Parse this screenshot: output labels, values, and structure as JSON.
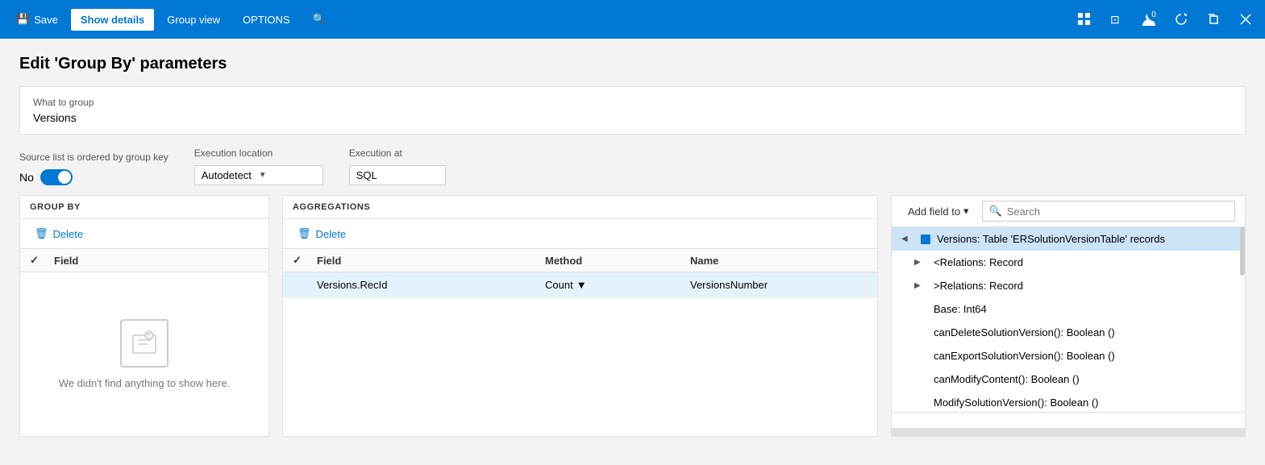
{
  "titleBar": {
    "save_label": "Save",
    "show_details_label": "Show details",
    "group_view_label": "Group view",
    "options_label": "OPTIONS",
    "icons": {
      "grid": "⊞",
      "office": "⊡",
      "user_badge": "0",
      "refresh": "↻",
      "restore": "⧉",
      "close": "✕"
    }
  },
  "page": {
    "title": "Edit 'Group By' parameters",
    "what_to_group_label": "What to group",
    "what_to_group_value": "Versions",
    "source_list_label": "Source list is ordered by group key",
    "toggle_value": "No",
    "execution_location_label": "Execution location",
    "execution_location_value": "Autodetect",
    "execution_at_label": "Execution at",
    "execution_at_value": "SQL"
  },
  "groupBy": {
    "section_label": "GROUP BY",
    "delete_label": "Delete",
    "field_col": "Field",
    "empty_text": "We didn't find anything to show here."
  },
  "aggregations": {
    "section_label": "AGGREGATIONS",
    "delete_label": "Delete",
    "field_col": "Field",
    "method_col": "Method",
    "name_col": "Name",
    "rows": [
      {
        "field": "Versions.RecId",
        "method": "Count",
        "name": "VersionsNumber"
      }
    ]
  },
  "fieldPicker": {
    "add_field_label": "Add field to",
    "search_placeholder": "Search",
    "items": [
      {
        "label": "Versions: Table 'ERSolutionVersionTable' records",
        "level": 0,
        "expanded": true,
        "selected": true
      },
      {
        "label": "<Relations: Record",
        "level": 1,
        "expanded": false,
        "selected": false
      },
      {
        "label": ">Relations: Record",
        "level": 1,
        "expanded": false,
        "selected": false
      },
      {
        "label": "Base: Int64",
        "level": 1,
        "expanded": false,
        "selected": false
      },
      {
        "label": "canDeleteSolutionVersion(): Boolean ()",
        "level": 1,
        "expanded": false,
        "selected": false
      },
      {
        "label": "canExportSolutionVersion(): Boolean ()",
        "level": 1,
        "expanded": false,
        "selected": false
      },
      {
        "label": "canModifyContent(): Boolean ()",
        "level": 1,
        "expanded": false,
        "selected": false
      },
      {
        "label": "ModifySolutionVersion(): Boolean ()",
        "level": 1,
        "expanded": false,
        "selected": false
      }
    ]
  }
}
